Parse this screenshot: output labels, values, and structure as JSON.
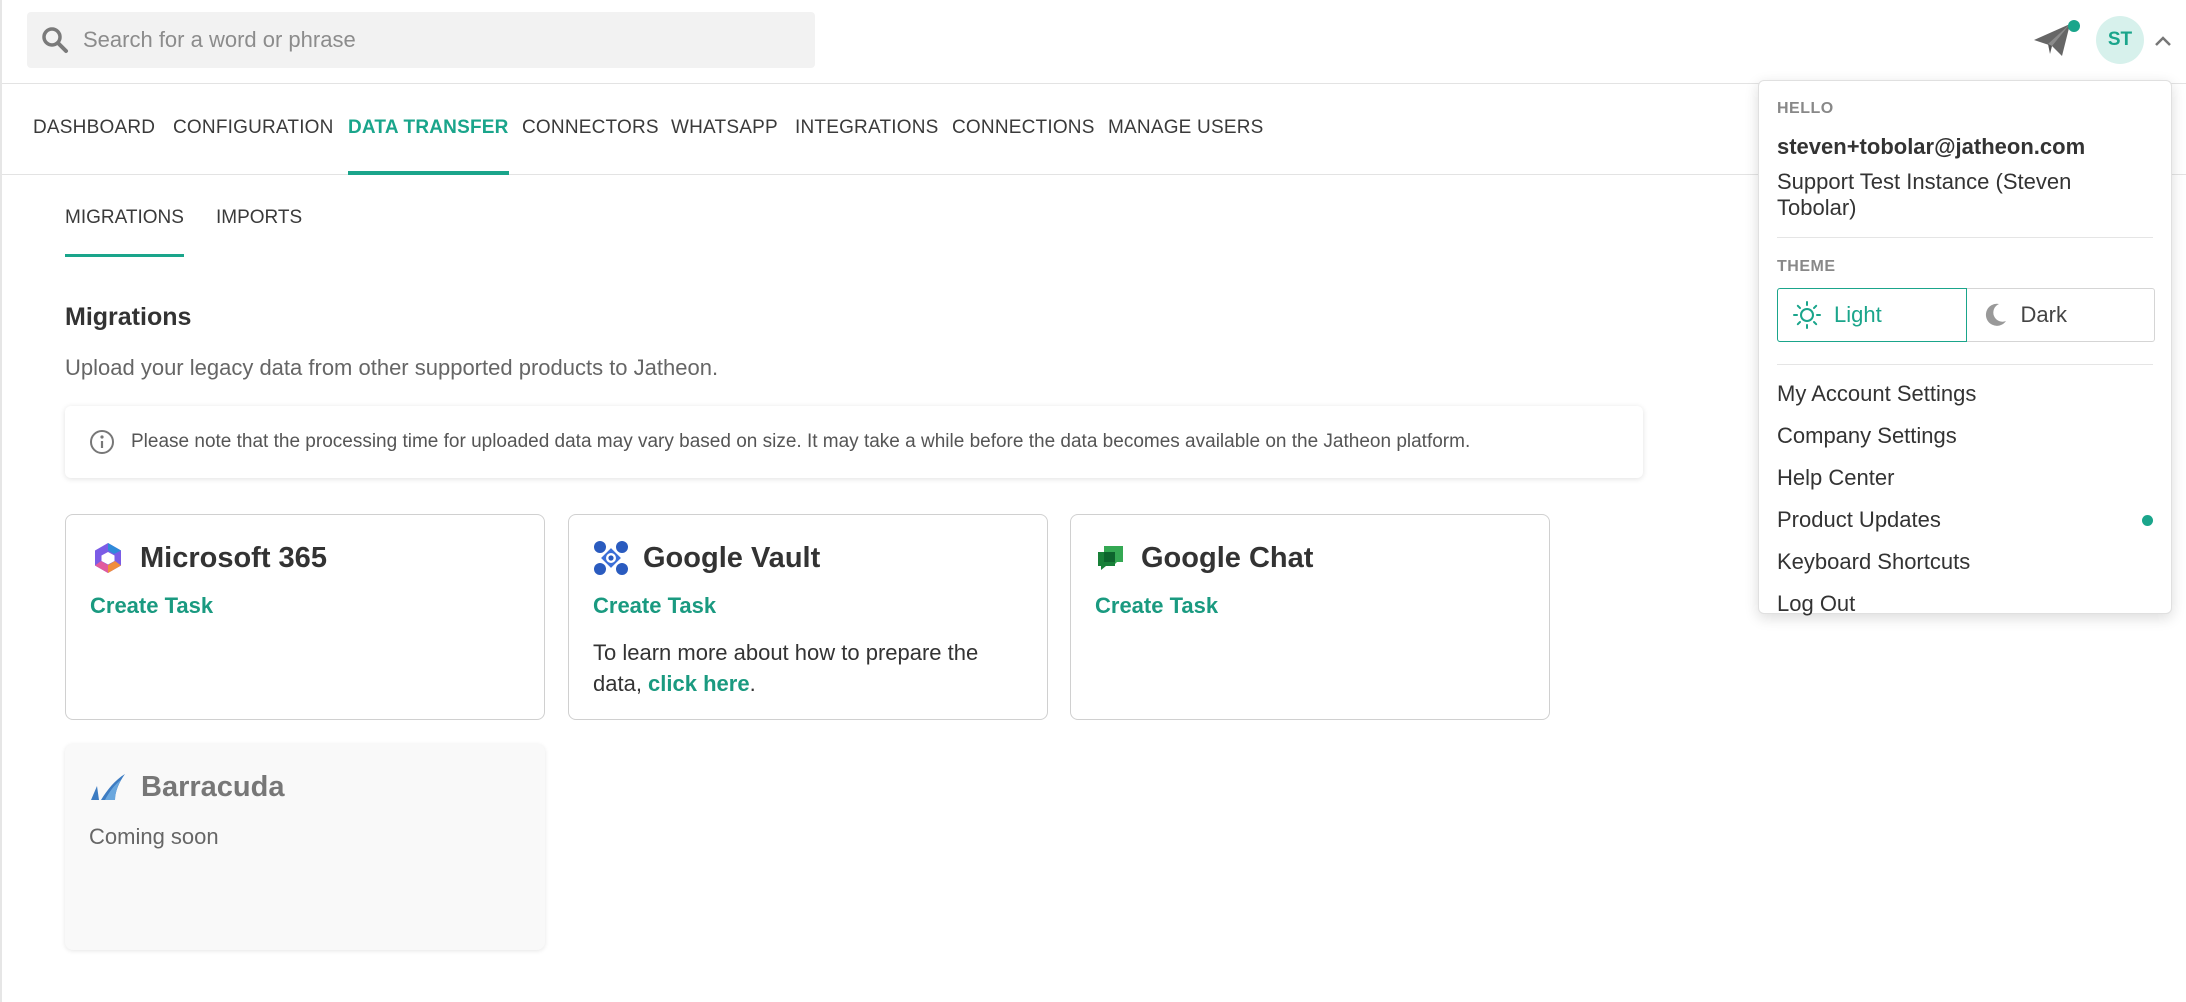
{
  "topbar": {
    "search_placeholder": "Search for a word or phrase",
    "avatar_initials": "ST"
  },
  "main_nav": {
    "tabs": [
      {
        "label": "DASHBOARD",
        "active": false
      },
      {
        "label": "CONFIGURATION",
        "active": false
      },
      {
        "label": "DATA TRANSFER",
        "active": true
      },
      {
        "label": "CONNECTORS",
        "active": false
      },
      {
        "label": "WHATSAPP",
        "active": false
      },
      {
        "label": "INTEGRATIONS",
        "active": false
      },
      {
        "label": "CONNECTIONS",
        "active": false
      },
      {
        "label": "MANAGE USERS",
        "active": false
      }
    ]
  },
  "sub_nav": {
    "tabs": [
      {
        "label": "MIGRATIONS",
        "active": true
      },
      {
        "label": "IMPORTS",
        "active": false
      }
    ]
  },
  "migrations": {
    "title": "Migrations",
    "subtitle": "Upload your legacy data from other supported products to Jatheon.",
    "note": "Please note that the processing time for uploaded data may vary based on size. It may take a while before the data becomes available on the Jatheon platform.",
    "cards": [
      {
        "title": "Microsoft 365",
        "action": "Create Task",
        "icon": "microsoft-365-icon"
      },
      {
        "title": "Google Vault",
        "action": "Create Task",
        "text_before": "To learn more about how to prepare the data, ",
        "link": "click here",
        "text_after": ".",
        "icon": "google-vault-icon"
      },
      {
        "title": "Google Chat",
        "action": "Create Task",
        "icon": "google-chat-icon"
      },
      {
        "title": "Barracuda",
        "status": "Coming soon",
        "icon": "barracuda-icon"
      }
    ]
  },
  "user_menu": {
    "hello_label": "HELLO",
    "email": "steven+tobolar@jatheon.com",
    "company": "Support Test Instance (Steven Tobolar)",
    "theme_label": "THEME",
    "theme_options": [
      {
        "label": "Light",
        "active": true
      },
      {
        "label": "Dark",
        "active": false
      }
    ],
    "items": [
      {
        "label": "My Account Settings"
      },
      {
        "label": "Company Settings"
      },
      {
        "label": "Help Center"
      },
      {
        "label": "Product Updates",
        "has_dot": true
      },
      {
        "label": "Keyboard Shortcuts"
      },
      {
        "label": "Log Out"
      }
    ]
  },
  "colors": {
    "accent": "#1aa58b",
    "link": "#1a9a80",
    "text": "#333333",
    "muted": "#666666"
  }
}
